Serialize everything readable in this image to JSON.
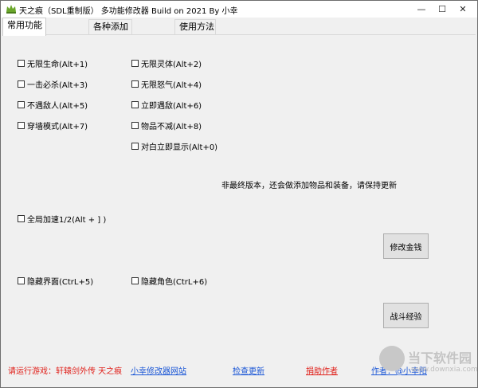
{
  "window": {
    "title": "天之痕（SDL重制版） 多功能修改器  Build on 2021 By 小幸",
    "minimize": "—",
    "maximize": "☐",
    "close": "✕"
  },
  "tabs": [
    {
      "label": "常用功能",
      "active": true
    },
    {
      "label": "各种添加",
      "active": false
    },
    {
      "label": "使用方法",
      "active": false
    }
  ],
  "cheats": {
    "c1": "无限生命(Alt+1)",
    "c2": "无限灵体(Alt+2)",
    "c3": "一击必杀(Alt+3)",
    "c4": "无限怒气(Alt+4)",
    "c5": "不遇敌人(Alt+5)",
    "c6": "立即遇敌(Alt+6)",
    "c7": "穿墙模式(Alt+7)",
    "c8": "物品不减(Alt+8)",
    "c9": "对白立即显示(Alt+0)",
    "speed": "全局加速1/2(Alt + ] )",
    "hide_ui": "隐藏界面(CtrL+5)",
    "hide_char": "隐藏角色(CtrL+6)"
  },
  "note": "非最终版本，还会做添加物品和装备，请保持更新",
  "buttons": {
    "money": "修改金钱",
    "exp": "战斗经验"
  },
  "footer": {
    "run_game": "请运行游戏：轩辕剑外传 天之痕",
    "site": "小幸修改器网站",
    "check_update": "检查更新",
    "donate": "捐助作者",
    "author": "作者：@小幸阳"
  },
  "watermark": {
    "brand": "当下软件园",
    "url": "www.downxia.com"
  },
  "colors": {
    "link": "#1a56d6",
    "warning": "#e0201a",
    "app_icon": "#6aa62a"
  },
  "icons": {
    "app": "green-crown-icon",
    "minimize": "minimize-icon",
    "maximize": "maximize-icon",
    "close": "close-icon"
  }
}
